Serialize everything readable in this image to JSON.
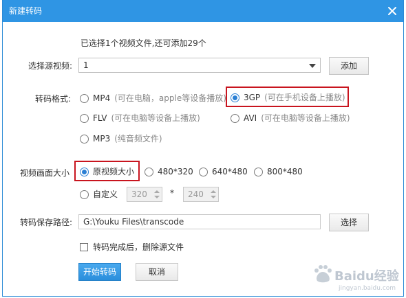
{
  "dialog": {
    "title": "新建转码"
  },
  "info_text": "已选择1个视频文件,还可添加29个",
  "source": {
    "label": "选择源视频:",
    "selected": "1",
    "add_button": "添加"
  },
  "format": {
    "label": "转码格式:",
    "options": [
      {
        "name": "MP4",
        "note": "(可在电脑，apple等设备播放)",
        "selected": false
      },
      {
        "name": "3GP",
        "note": "(可在手机设备上播放)",
        "selected": true
      },
      {
        "name": "FLV",
        "note": "(可在电脑等设备上播放)",
        "selected": false
      },
      {
        "name": "AVI",
        "note": "(可在电脑等设备上播放)",
        "selected": false
      },
      {
        "name": "MP3",
        "note": "(纯音频文件)",
        "selected": false
      }
    ]
  },
  "size": {
    "label": "视频画面大小",
    "options": [
      {
        "name": "原视频大小",
        "selected": true
      },
      {
        "name": "480*320",
        "selected": false
      },
      {
        "name": "640*480",
        "selected": false
      },
      {
        "name": "800*480",
        "selected": false
      },
      {
        "name": "自定义",
        "selected": false
      }
    ],
    "width": "320",
    "height": "240",
    "separator": "*"
  },
  "path": {
    "label": "转码保存路径:",
    "value": "G:\\Youku Files\\transcode",
    "browse_button": "选择"
  },
  "delete_source": {
    "label": "转码完成后，删除源文件",
    "checked": false
  },
  "actions": {
    "start": "开始转码",
    "cancel": "取消"
  },
  "colors": {
    "titlebar": "#2f95e4",
    "highlight": "#c8141e",
    "radio_on": "#2a7fd4"
  },
  "watermark": {
    "text": "Baidu经验",
    "sub": "jingyan.baidu.com"
  }
}
